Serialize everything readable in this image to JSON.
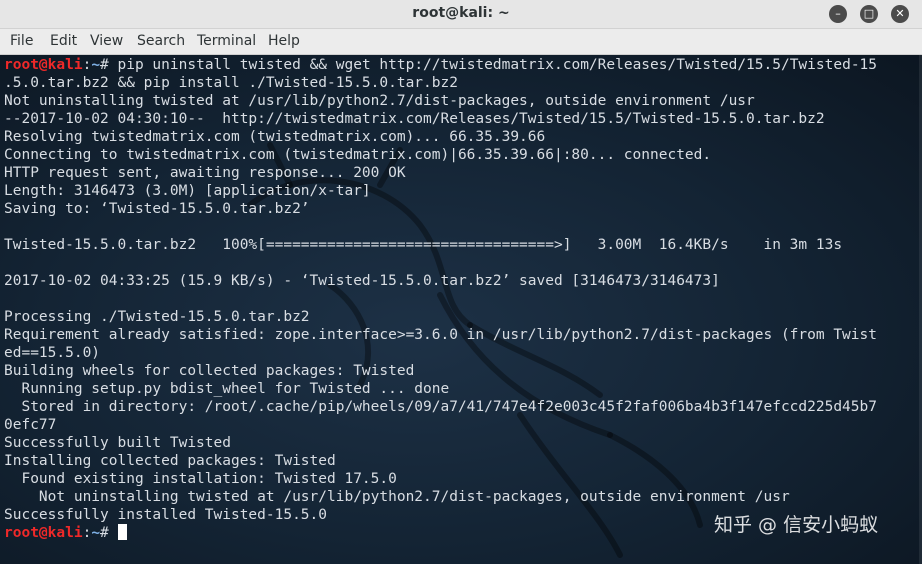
{
  "window": {
    "title": "root@kali: ~",
    "minimize_icon": "minimize-icon",
    "maximize_icon": "maximize-icon",
    "close_icon": "close-icon"
  },
  "menubar": {
    "items": [
      "File",
      "Edit",
      "View",
      "Search",
      "Terminal",
      "Help"
    ]
  },
  "prompt": {
    "user": "root@kali",
    "sep": ":",
    "path": "~",
    "symbol": "# "
  },
  "terminal": {
    "lines": [
      {
        "prompt": true,
        "text": "pip uninstall twisted && wget http://twistedmatrix.com/Releases/Twisted/15.5/Twisted-15"
      },
      {
        "text": ".5.0.tar.bz2 && pip install ./Twisted-15.5.0.tar.bz2"
      },
      {
        "text": "Not uninstalling twisted at /usr/lib/python2.7/dist-packages, outside environment /usr"
      },
      {
        "text": "--2017-10-02 04:30:10--  http://twistedmatrix.com/Releases/Twisted/15.5/Twisted-15.5.0.tar.bz2"
      },
      {
        "text": "Resolving twistedmatrix.com (twistedmatrix.com)... 66.35.39.66"
      },
      {
        "text": "Connecting to twistedmatrix.com (twistedmatrix.com)|66.35.39.66|:80... connected."
      },
      {
        "text": "HTTP request sent, awaiting response... 200 OK"
      },
      {
        "text": "Length: 3146473 (3.0M) [application/x-tar]"
      },
      {
        "text": "Saving to: ‘Twisted-15.5.0.tar.bz2’"
      },
      {
        "text": ""
      },
      {
        "text": "Twisted-15.5.0.tar.bz2   100%[=================================>]   3.00M  16.4KB/s    in 3m 13s"
      },
      {
        "text": ""
      },
      {
        "text": "2017-10-02 04:33:25 (15.9 KB/s) - ‘Twisted-15.5.0.tar.bz2’ saved [3146473/3146473]"
      },
      {
        "text": ""
      },
      {
        "text": "Processing ./Twisted-15.5.0.tar.bz2"
      },
      {
        "text": "Requirement already satisfied: zope.interface>=3.6.0 in /usr/lib/python2.7/dist-packages (from Twist"
      },
      {
        "text": "ed==15.5.0)"
      },
      {
        "text": "Building wheels for collected packages: Twisted"
      },
      {
        "text": "  Running setup.py bdist_wheel for Twisted ... done"
      },
      {
        "text": "  Stored in directory: /root/.cache/pip/wheels/09/a7/41/747e4f2e003c45f2faf006ba4b3f147efccd225d45b7"
      },
      {
        "text": "0efc77"
      },
      {
        "text": "Successfully built Twisted"
      },
      {
        "text": "Installing collected packages: Twisted"
      },
      {
        "text": "  Found existing installation: Twisted 17.5.0"
      },
      {
        "text": "    Not uninstalling twisted at /usr/lib/python2.7/dist-packages, outside environment /usr"
      },
      {
        "text": "Successfully installed Twisted-15.5.0"
      },
      {
        "prompt": true,
        "text": "",
        "cursor": true
      }
    ]
  },
  "watermark": "知乎 @ 信安小蚂蚁"
}
